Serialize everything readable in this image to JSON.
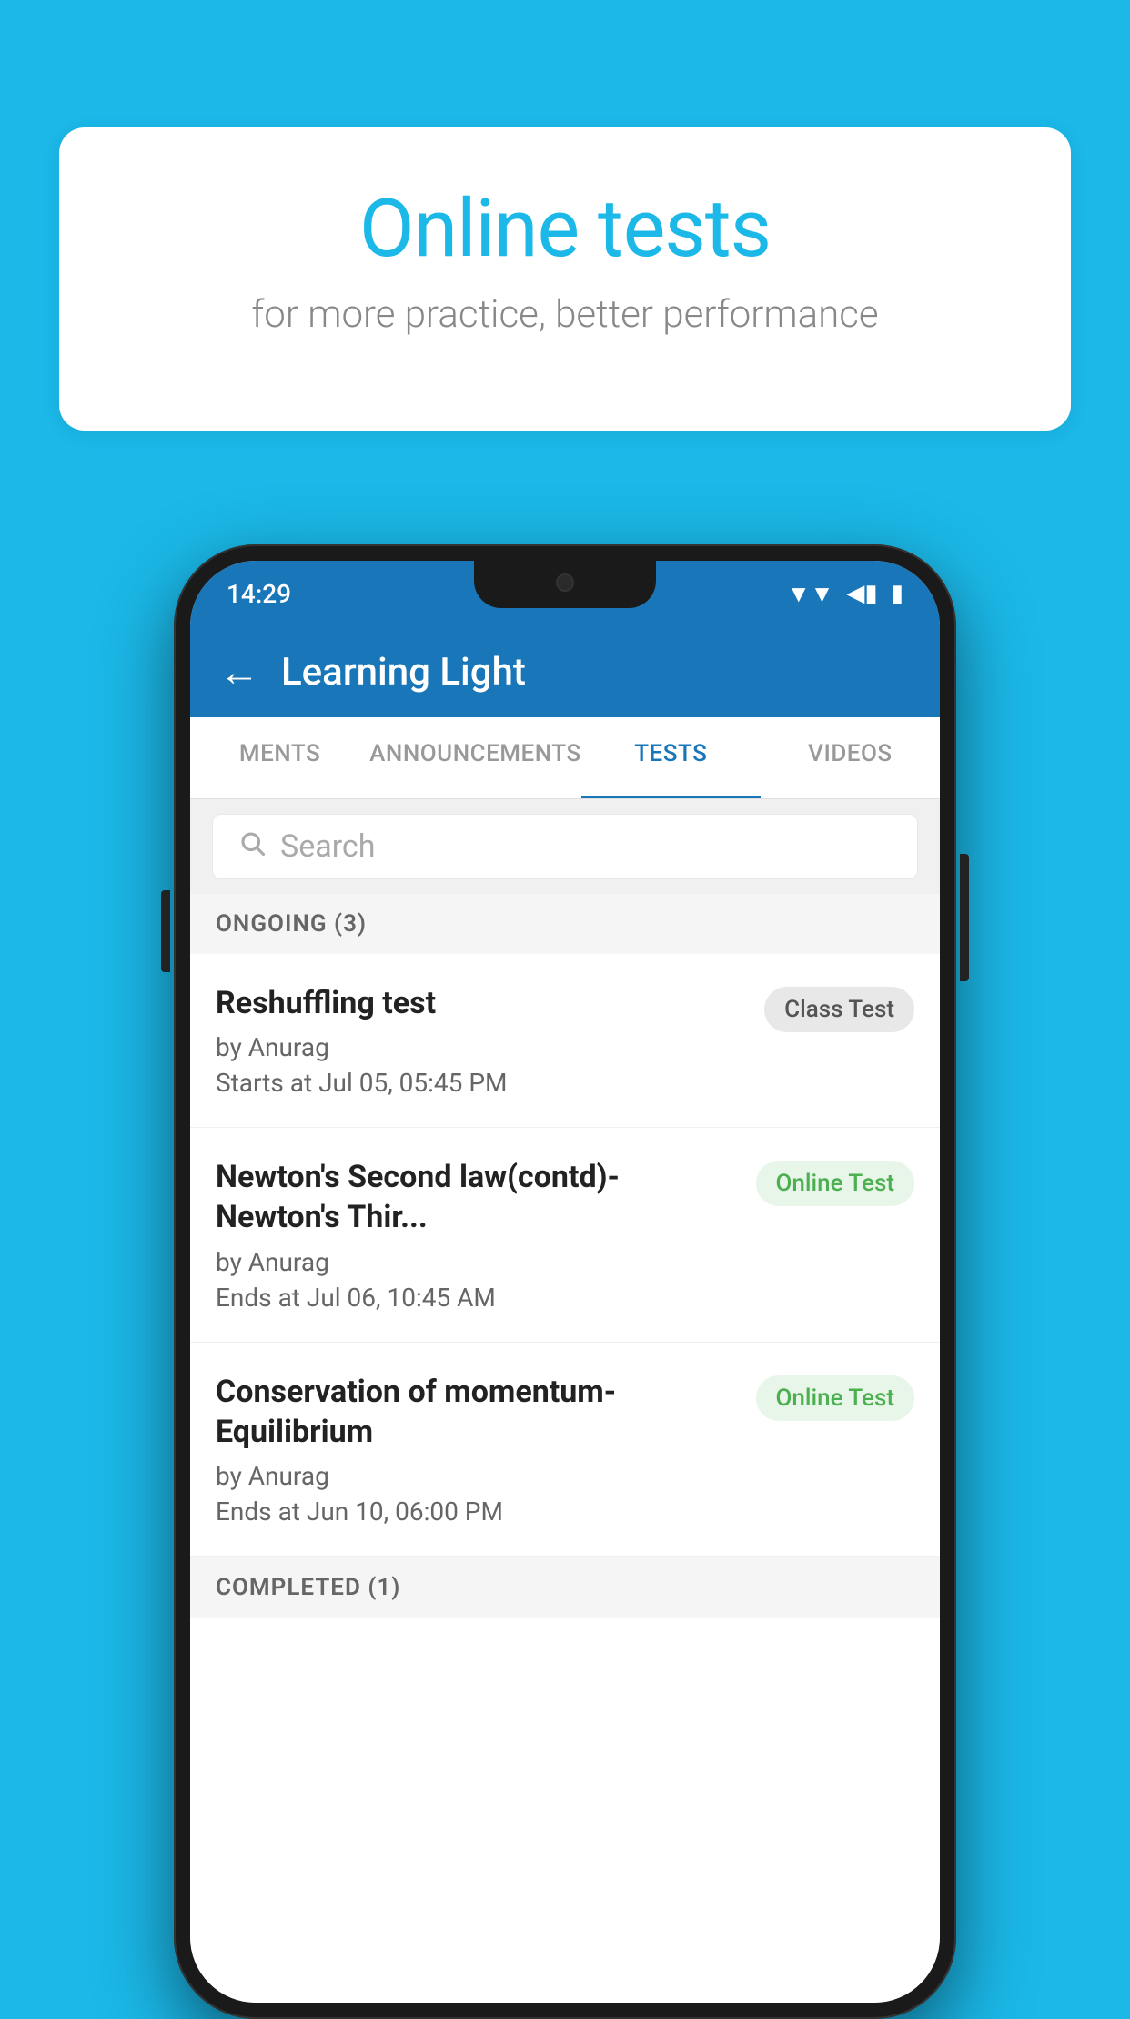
{
  "background_color": "#1BB8E8",
  "speech_bubble": {
    "title": "Online tests",
    "subtitle": "for more practice, better performance"
  },
  "status_bar": {
    "time": "14:29",
    "wifi_icon": "▼",
    "signal_icon": "◀",
    "battery_icon": "▮"
  },
  "app_header": {
    "back_label": "←",
    "title": "Learning Light"
  },
  "tabs": [
    {
      "label": "MENTS",
      "active": false
    },
    {
      "label": "ANNOUNCEMENTS",
      "active": false
    },
    {
      "label": "TESTS",
      "active": true
    },
    {
      "label": "VIDEOS",
      "active": false
    }
  ],
  "search": {
    "placeholder": "Search",
    "icon": "🔍"
  },
  "ongoing_section": {
    "header": "ONGOING (3)"
  },
  "test_items": [
    {
      "name": "Reshuffling test",
      "by": "by Anurag",
      "date": "Starts at  Jul 05, 05:45 PM",
      "badge": "Class Test",
      "badge_type": "class"
    },
    {
      "name": "Newton's Second law(contd)-Newton's Thir...",
      "by": "by Anurag",
      "date": "Ends at  Jul 06, 10:45 AM",
      "badge": "Online Test",
      "badge_type": "online"
    },
    {
      "name": "Conservation of momentum-Equilibrium",
      "by": "by Anurag",
      "date": "Ends at  Jun 10, 06:00 PM",
      "badge": "Online Test",
      "badge_type": "online"
    }
  ],
  "completed_section": {
    "header": "COMPLETED (1)"
  }
}
